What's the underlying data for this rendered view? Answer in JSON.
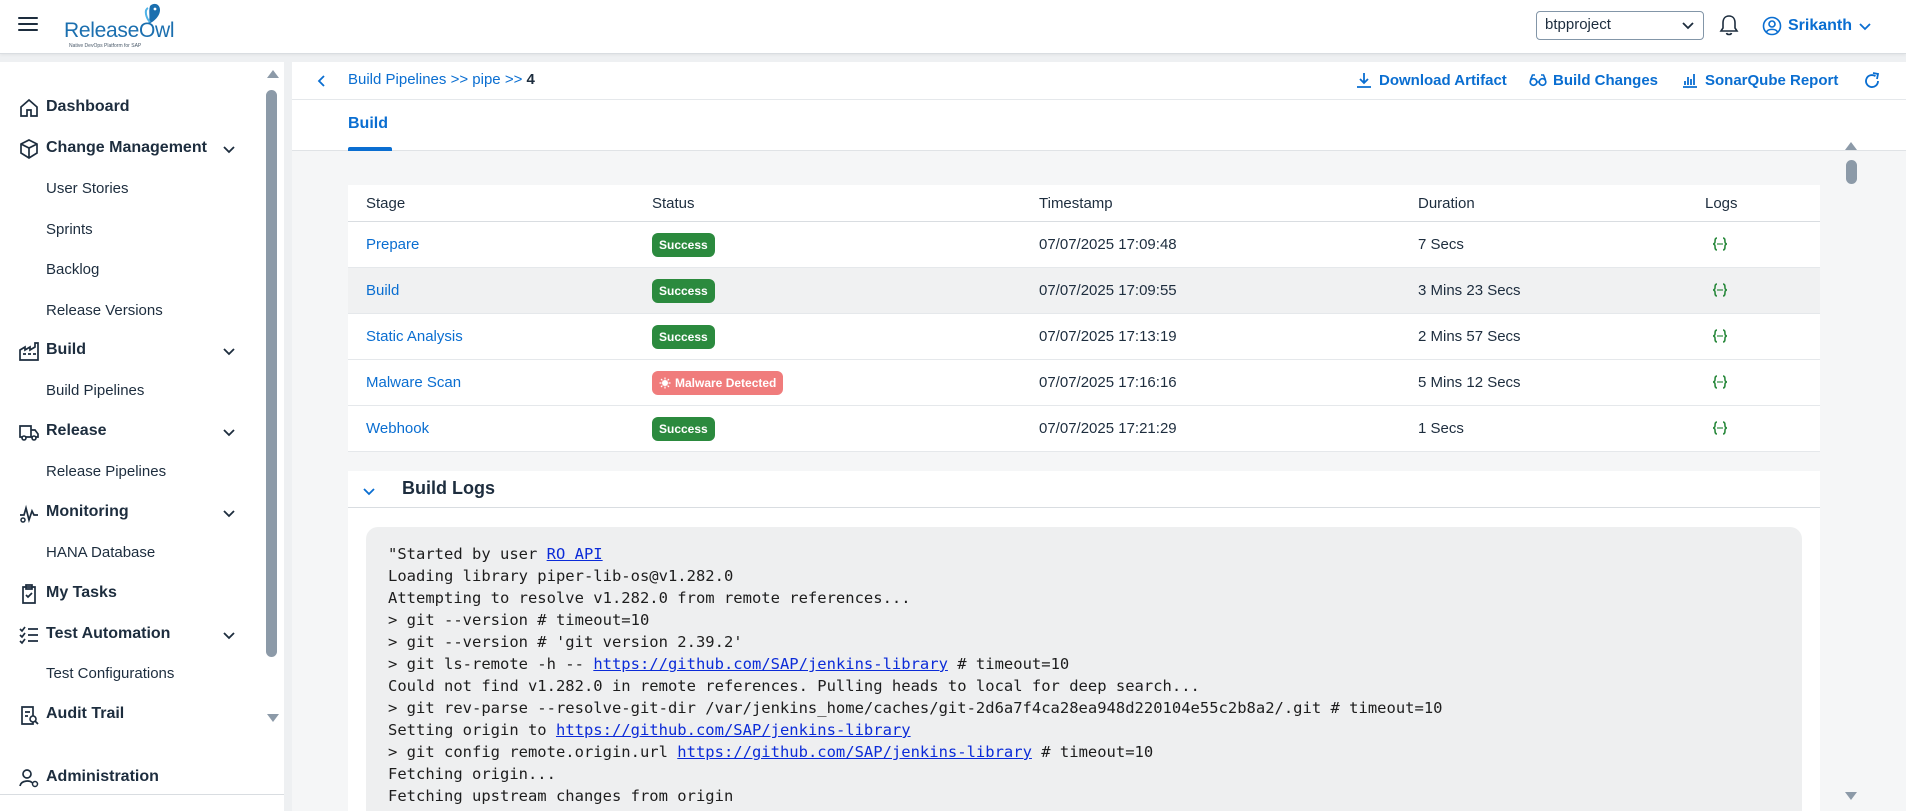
{
  "app": {
    "logo_name": "ReleaseOwl",
    "logo_tagline": "Native DevOps Platform for SAP",
    "project": "btpproject",
    "user": "Srikanth"
  },
  "colors": {
    "accent": "#0a6ed1",
    "success": "#2b8a3e",
    "malware": "#f07c7c",
    "text": "#1d2d3e"
  },
  "sidebar": {
    "items": [
      {
        "label": "Dashboard",
        "icon": "home-icon"
      },
      {
        "label": "Change Management",
        "icon": "box-icon",
        "children": [
          "User Stories",
          "Sprints",
          "Backlog",
          "Release Versions"
        ]
      },
      {
        "label": "Build",
        "icon": "factory-icon",
        "children": [
          "Build Pipelines"
        ]
      },
      {
        "label": "Release",
        "icon": "truck-icon",
        "children": [
          "Release Pipelines"
        ]
      },
      {
        "label": "Monitoring",
        "icon": "pulse-icon",
        "children": [
          "HANA Database"
        ]
      },
      {
        "label": "My Tasks",
        "icon": "clipboard-icon"
      },
      {
        "label": "Test Automation",
        "icon": "checklist-icon",
        "children": [
          "Test Configurations"
        ]
      },
      {
        "label": "Audit Trail",
        "icon": "audit-icon"
      },
      {
        "label": "Administration",
        "icon": "admin-user-icon"
      }
    ]
  },
  "breadcrumb": {
    "items": [
      "Build Pipelines",
      "pipe",
      "4"
    ],
    "separator": ">>"
  },
  "toolbar": {
    "download_artifact": "Download Artifact",
    "build_changes": "Build Changes",
    "sonarqube_report": "SonarQube Report"
  },
  "tabs": [
    {
      "label": "Build",
      "selected": true
    }
  ],
  "table": {
    "columns": [
      "Stage",
      "Status",
      "Timestamp",
      "Duration",
      "Logs"
    ],
    "rows": [
      {
        "stage": "Prepare",
        "status": "Success",
        "timestamp": "07/07/2025 17:09:48",
        "duration": "7 Secs"
      },
      {
        "stage": "Build",
        "status": "Success",
        "timestamp": "07/07/2025 17:09:55",
        "duration": "3 Mins 23 Secs"
      },
      {
        "stage": "Static Analysis",
        "status": "Success",
        "timestamp": "07/07/2025 17:13:19",
        "duration": "2 Mins 57 Secs"
      },
      {
        "stage": "Malware Scan",
        "status": "Malware Detected",
        "timestamp": "07/07/2025 17:16:16",
        "duration": "5 Mins 12 Secs"
      },
      {
        "stage": "Webhook",
        "status": "Success",
        "timestamp": "07/07/2025 17:21:29",
        "duration": "1 Secs"
      }
    ]
  },
  "build_logs": {
    "title": "Build Logs",
    "started_prefix": "\"Started by user ",
    "started_user": "RO API",
    "line_2": "Loading library piper-lib-os@v1.282.0",
    "line_3": "Attempting to resolve v1.282.0 from remote references...",
    "line_4": "> git --version # timeout=10",
    "line_5": "> git --version # 'git version 2.39.2'",
    "line_6_prefix": "> git ls-remote -h -- ",
    "repo_url": "https://github.com/SAP/jenkins-library",
    "line_6_suffix": " # timeout=10",
    "line_7": "Could not find v1.282.0 in remote references. Pulling heads to local for deep search...",
    "line_8": "> git rev-parse --resolve-git-dir /var/jenkins_home/caches/git-2d6a7f4ca28ea948d220104e55c2b8a2/.git # timeout=10",
    "line_9_prefix": "Setting origin to ",
    "line_10_prefix": "> git config remote.origin.url ",
    "line_10_suffix": " # timeout=10",
    "line_11": "Fetching origin...",
    "line_12": "Fetching upstream changes from origin"
  }
}
